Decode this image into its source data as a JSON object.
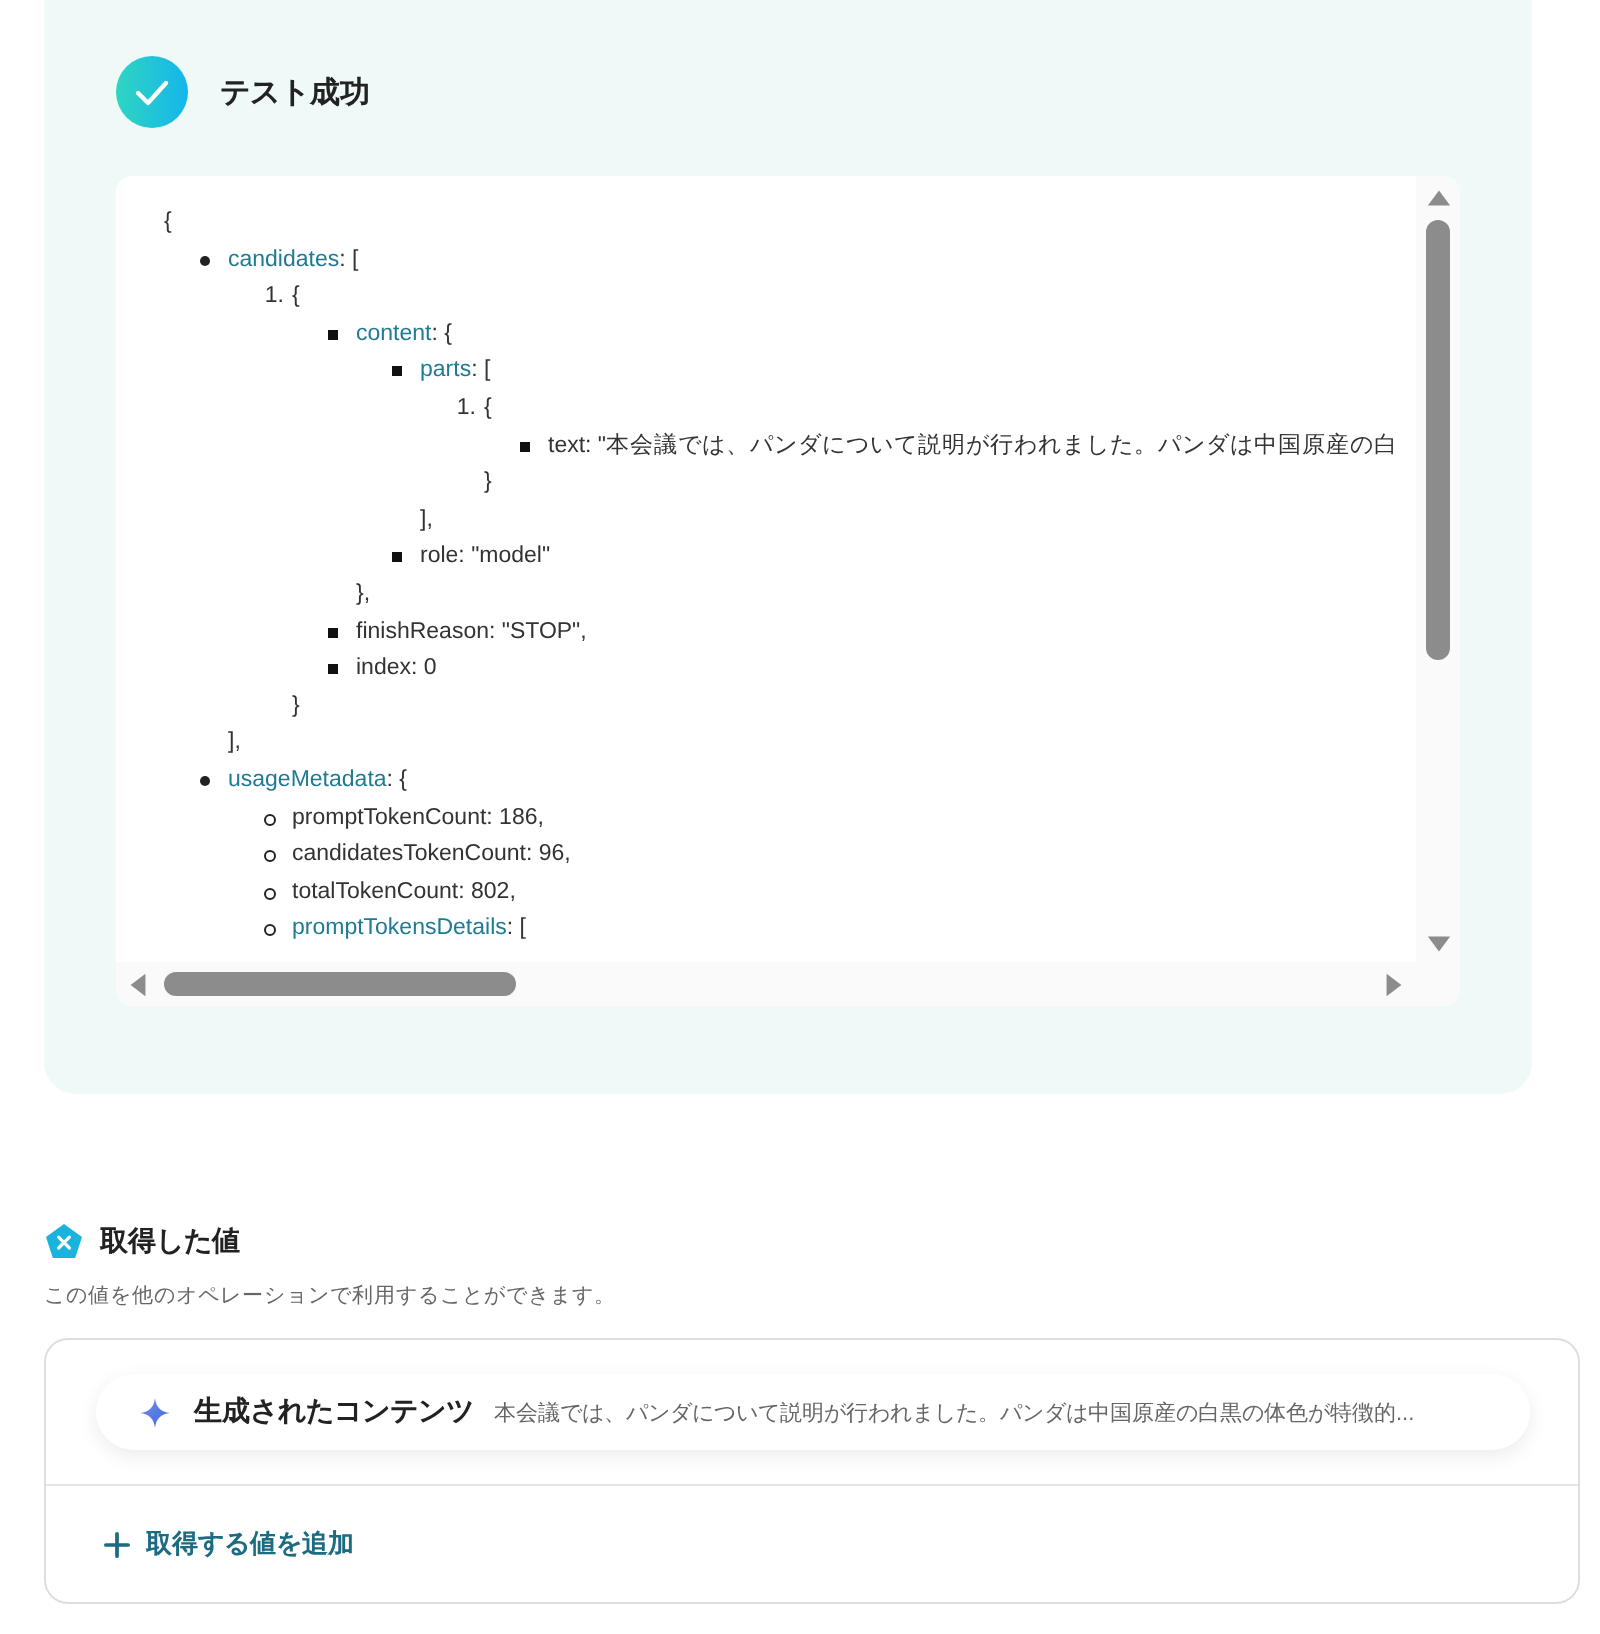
{
  "result": {
    "title": "テスト成功",
    "tree": [
      {
        "open": "{",
        "children": [
          {
            "kind": "disc",
            "key": "candidates",
            "open": ": [",
            "close": "],",
            "children": [
              {
                "kind": "number",
                "number": "1.",
                "open": "{",
                "close": "}",
                "children": [
                  {
                    "kind": "square",
                    "key": "content",
                    "open": ": {",
                    "close": "},",
                    "children": [
                      {
                        "kind": "square",
                        "key": "parts",
                        "open": ": [",
                        "close": "],",
                        "children": [
                          {
                            "kind": "number",
                            "number": "1.",
                            "open": "{",
                            "close": "}",
                            "children": [
                              {
                                "kind": "square",
                                "open": "text: \"本会議では、パンダについて説明が行われました。パンダは中国原産の白"
                              }
                            ]
                          }
                        ]
                      },
                      {
                        "kind": "square",
                        "open": "role: \"model\""
                      }
                    ]
                  },
                  {
                    "kind": "square",
                    "open": "finishReason: \"STOP\","
                  },
                  {
                    "kind": "square",
                    "open": "index: 0"
                  }
                ]
              }
            ]
          },
          {
            "kind": "disc",
            "key": "usageMetadata",
            "open": ": {",
            "children": [
              {
                "kind": "circle",
                "open": "promptTokenCount: 186,"
              },
              {
                "kind": "circle",
                "open": "candidatesTokenCount: 96,"
              },
              {
                "kind": "circle",
                "open": "totalTokenCount: 802,"
              },
              {
                "kind": "circle",
                "key": "promptTokensDetails",
                "open": ": ["
              }
            ]
          }
        ]
      }
    ]
  },
  "acquired": {
    "title": "取得した値",
    "description": "この値を他のオペレーションで利用することができます。",
    "values": [
      {
        "name": "生成されたコンテンツ",
        "preview": "本会議では、パンダについて説明が行われました。パンダは中国原産の白黒の体色が特徴的..."
      }
    ],
    "add_label": "取得する値を追加"
  }
}
